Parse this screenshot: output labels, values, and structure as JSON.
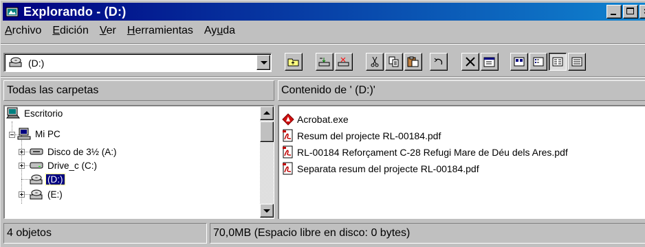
{
  "window": {
    "title": "Explorando -  (D:)",
    "icon": "explorer-icon",
    "caption_buttons": [
      "minimize-icon",
      "maximize-icon",
      "close-icon"
    ]
  },
  "menu": [
    {
      "pre": "",
      "u": "A",
      "post": "rchivo"
    },
    {
      "pre": "",
      "u": "E",
      "post": "dición"
    },
    {
      "pre": "",
      "u": "V",
      "post": "er"
    },
    {
      "pre": "",
      "u": "H",
      "post": "erramientas"
    },
    {
      "pre": "Ay",
      "u": "u",
      "post": "da"
    }
  ],
  "address": {
    "value": "(D:)",
    "icon": "cd-drive-icon"
  },
  "toolbar_buttons": [
    "up-folder-icon",
    "map-drive-icon",
    "disconnect-drive-icon",
    "cut-icon",
    "copy-icon",
    "paste-icon",
    "undo-icon",
    "delete-icon",
    "properties-icon",
    "large-icons-view-icon",
    "small-icons-view-icon",
    "list-view-icon",
    "details-view-icon"
  ],
  "panes": {
    "left_header": "Todas las carpetas",
    "right_header": "Contenido de ' (D:)'"
  },
  "tree": [
    {
      "label": "Escritorio",
      "icon": "desktop-icon"
    },
    {
      "label": "Mi PC",
      "icon": "my-computer-icon"
    },
    {
      "label": "Disco de 3½ (A:)",
      "icon": "floppy-drive-icon"
    },
    {
      "label": "Drive_c (C:)",
      "icon": "hard-drive-icon"
    },
    {
      "label": "(D:)",
      "icon": "cd-drive-icon",
      "selected": true
    },
    {
      "label": "(E:)",
      "icon": "cd-drive-icon"
    }
  ],
  "files": [
    {
      "name": "Acrobat.exe",
      "icon": "acrobat-exe-icon"
    },
    {
      "name": "Resum del projecte RL-00184.pdf",
      "icon": "pdf-icon"
    },
    {
      "name": "RL-00184 Reforçament C-28 Refugi Mare de Déu dels Ares.pdf",
      "icon": "pdf-icon"
    },
    {
      "name": "Separata resum del projecte RL-00184.pdf",
      "icon": "pdf-icon"
    }
  ],
  "status": {
    "count": "4 objetos",
    "space": "70,0MB (Espacio libre en disco: 0 bytes)"
  },
  "colors": {
    "titlebar": "#000080",
    "selection": "#000080",
    "face": "#c0c0c0"
  }
}
